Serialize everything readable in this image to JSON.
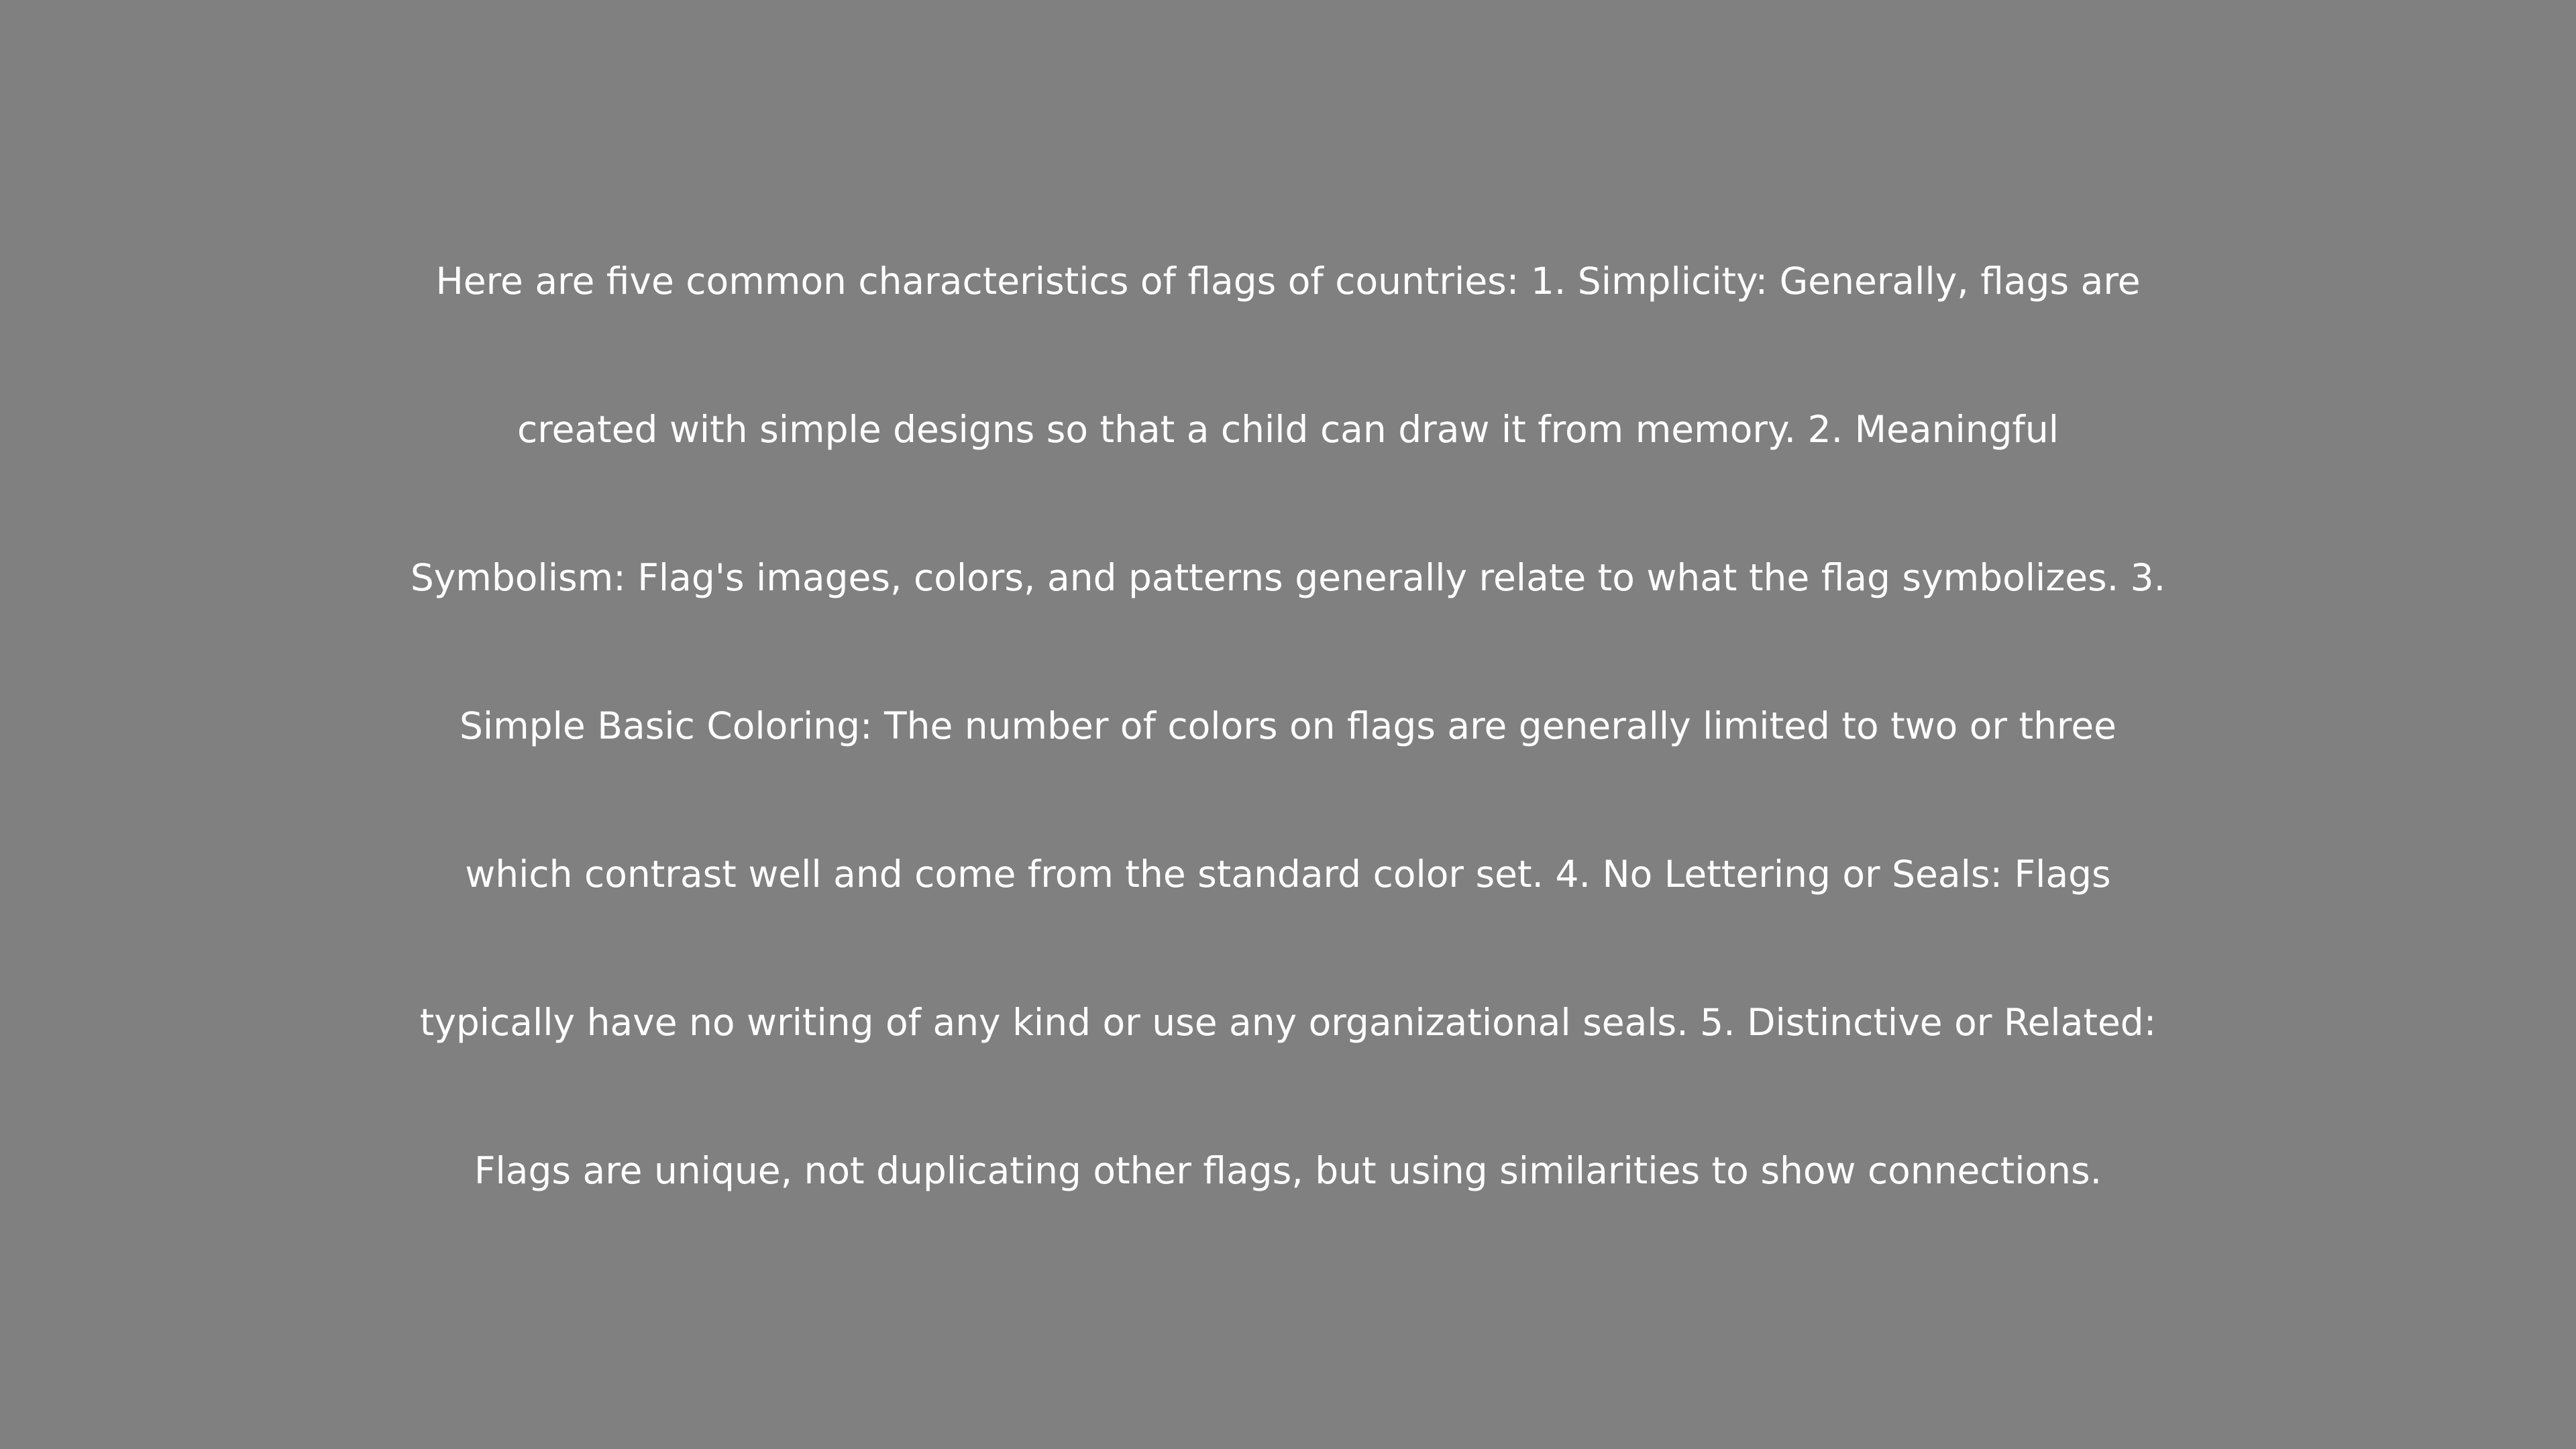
{
  "background_color": "#808080",
  "text_color": "#ffffff",
  "lines": [
    "Here are five common characteristics of flags of countries: 1. Simplicity: Generally, flags are",
    "created with simple designs so that a child can draw it from memory. 2. Meaningful",
    "Symbolism: Flag's images, colors, and patterns generally relate to what the flag symbolizes. 3.",
    "Simple Basic Coloring: The number of colors on flags are generally limited to two or three",
    "which contrast well and come from the standard color set. 4. No Lettering or Seals: Flags",
    "typically have no writing of any kind or use any organizational seals. 5. Distinctive or Related:",
    "Flags are unique, not duplicating other flags, but using similarities to show connections."
  ]
}
